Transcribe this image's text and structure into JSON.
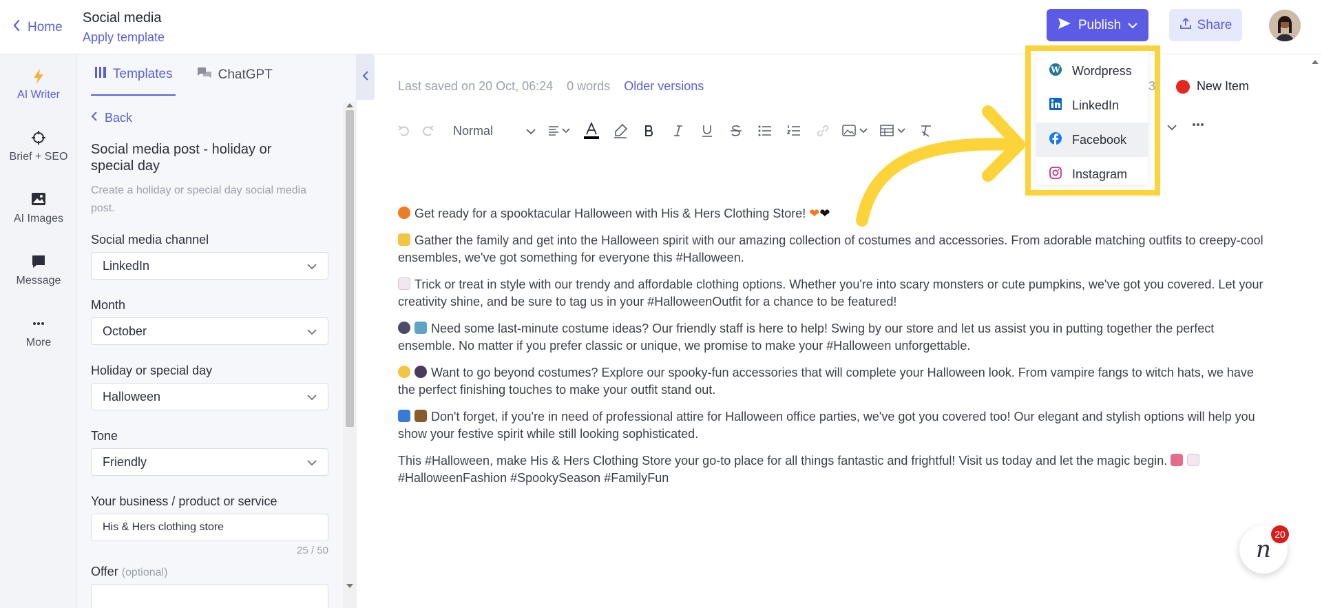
{
  "header": {
    "home_label": "Home",
    "doc_title": "Social media",
    "doc_subtitle": "Apply template",
    "publish_label": "Publish",
    "share_label": "Share"
  },
  "rail": [
    {
      "label": "AI Writer",
      "icon": "lightning-icon"
    },
    {
      "label": "Brief + SEO",
      "icon": "crosshair-icon"
    },
    {
      "label": "AI Images",
      "icon": "image-icon"
    },
    {
      "label": "Message",
      "icon": "message-icon"
    },
    {
      "label": "More",
      "icon": "more-icon"
    }
  ],
  "panel": {
    "tabs": [
      {
        "label": "Templates",
        "icon": "templates-icon"
      },
      {
        "label": "ChatGPT",
        "icon": "chat-icon"
      }
    ],
    "back_label": "Back",
    "template_title": "Social media post - holiday or special day",
    "template_description": "Create a holiday or special day social media post.",
    "fields": {
      "channel": {
        "label": "Social media channel",
        "value": "LinkedIn"
      },
      "month": {
        "label": "Month",
        "value": "October"
      },
      "holiday": {
        "label": "Holiday or special day",
        "value": "Halloween"
      },
      "tone": {
        "label": "Tone",
        "value": "Friendly"
      },
      "business": {
        "label": "Your business / product or service",
        "value": "His & Hers clothing store",
        "counter": "25 / 50"
      },
      "offer": {
        "label": "Offer",
        "optional": "(optional)"
      }
    }
  },
  "editor": {
    "last_saved": "Last saved on 20 Oct, 06:24",
    "word_count": "0 words",
    "older_versions": "Older versions",
    "partial_number": "3",
    "new_item": "New Item",
    "style_select": "Normal",
    "paragraphs": [
      "Get ready for a spooktacular Halloween with His & Hers Clothing Store!",
      "Gather the family and get into the Halloween spirit with our amazing collection of costumes and accessories. From adorable matching outfits to creepy-cool ensembles, we've got something for everyone this #Halloween.",
      "Trick or treat in style with our trendy and affordable clothing options. Whether you're into scary monsters or cute pumpkins, we've got you covered. Let your creativity shine, and be sure to tag us in your #HalloweenOutfit for a chance to be featured!",
      "Need some last-minute costume ideas? Our friendly staff is here to help! Swing by our store and let us assist you in putting together the perfect ensemble. No matter if you prefer classic or unique, we promise to make your #Halloween unforgettable.",
      "Want to go beyond costumes? Explore our spooky-fun accessories that will complete your Halloween look. From vampire fangs to witch hats, we have the perfect finishing touches to make your outfit stand out.",
      "Don't forget, if you're in need of professional attire for Halloween office parties, we've got you covered too! Our elegant and stylish options will help you show your festive spirit while still looking sophisticated.",
      "This #Halloween, make His & Hers Clothing Store your go-to place for all things fantastic and frightful! Visit us today and let the magic begin.",
      "#HalloweenFashion #SpookySeason #FamilyFun"
    ]
  },
  "publish_menu": [
    {
      "label": "Wordpress",
      "icon": "wordpress-icon",
      "color": "#21759b"
    },
    {
      "label": "LinkedIn",
      "icon": "linkedin-icon",
      "color": "#0a66c2"
    },
    {
      "label": "Facebook",
      "icon": "facebook-icon",
      "color": "#1877f2"
    },
    {
      "label": "Instagram",
      "icon": "instagram-icon",
      "color": "#c13584"
    }
  ],
  "chat_badge": "20",
  "colors": {
    "accent": "#5b5be6",
    "highlight": "#fdd33a",
    "new_item_dot": "#e5271f"
  }
}
